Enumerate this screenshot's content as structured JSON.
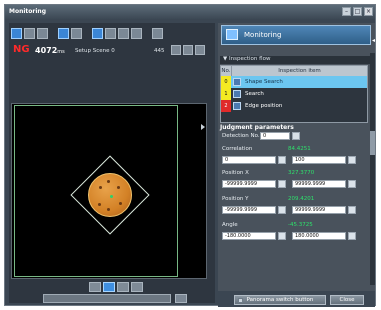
{
  "window": {
    "title": "Monitoring"
  },
  "status": {
    "judgement": "NG",
    "time_value": "4072",
    "time_unit": "ms",
    "scene": "Setup Scene 0",
    "zoom": "445"
  },
  "right_panel": {
    "title": "Monitoring",
    "section": "Inspection flow",
    "table_headers": [
      "No.",
      "Inspection item"
    ],
    "items": [
      {
        "no": "0",
        "label": "Shape Search"
      },
      {
        "no": "1",
        "label": "Search"
      },
      {
        "no": "2",
        "label": "Edge position"
      }
    ],
    "params": {
      "heading": "Judgment parameters",
      "detection_label": "Detection No.",
      "detection_value": "0",
      "correlation_label": "Correlation",
      "correlation_value": "84.4251",
      "corr_min": "0",
      "corr_max": "100",
      "posx_label": "Position X",
      "posx_value": "327.3770",
      "posx_min": "-99999.9999",
      "posx_max": "99999.9999",
      "posy_label": "Position Y",
      "posy_value": "209.4201",
      "posy_min": "-99999.9999",
      "posy_max": "99999.9999",
      "angle_label": "Angle",
      "angle_value": "-45.3725",
      "angle_min": "-180.0000",
      "angle_max": "180.0000"
    }
  },
  "buttons": {
    "panorama": "Panorama switch button",
    "close": "Close"
  }
}
